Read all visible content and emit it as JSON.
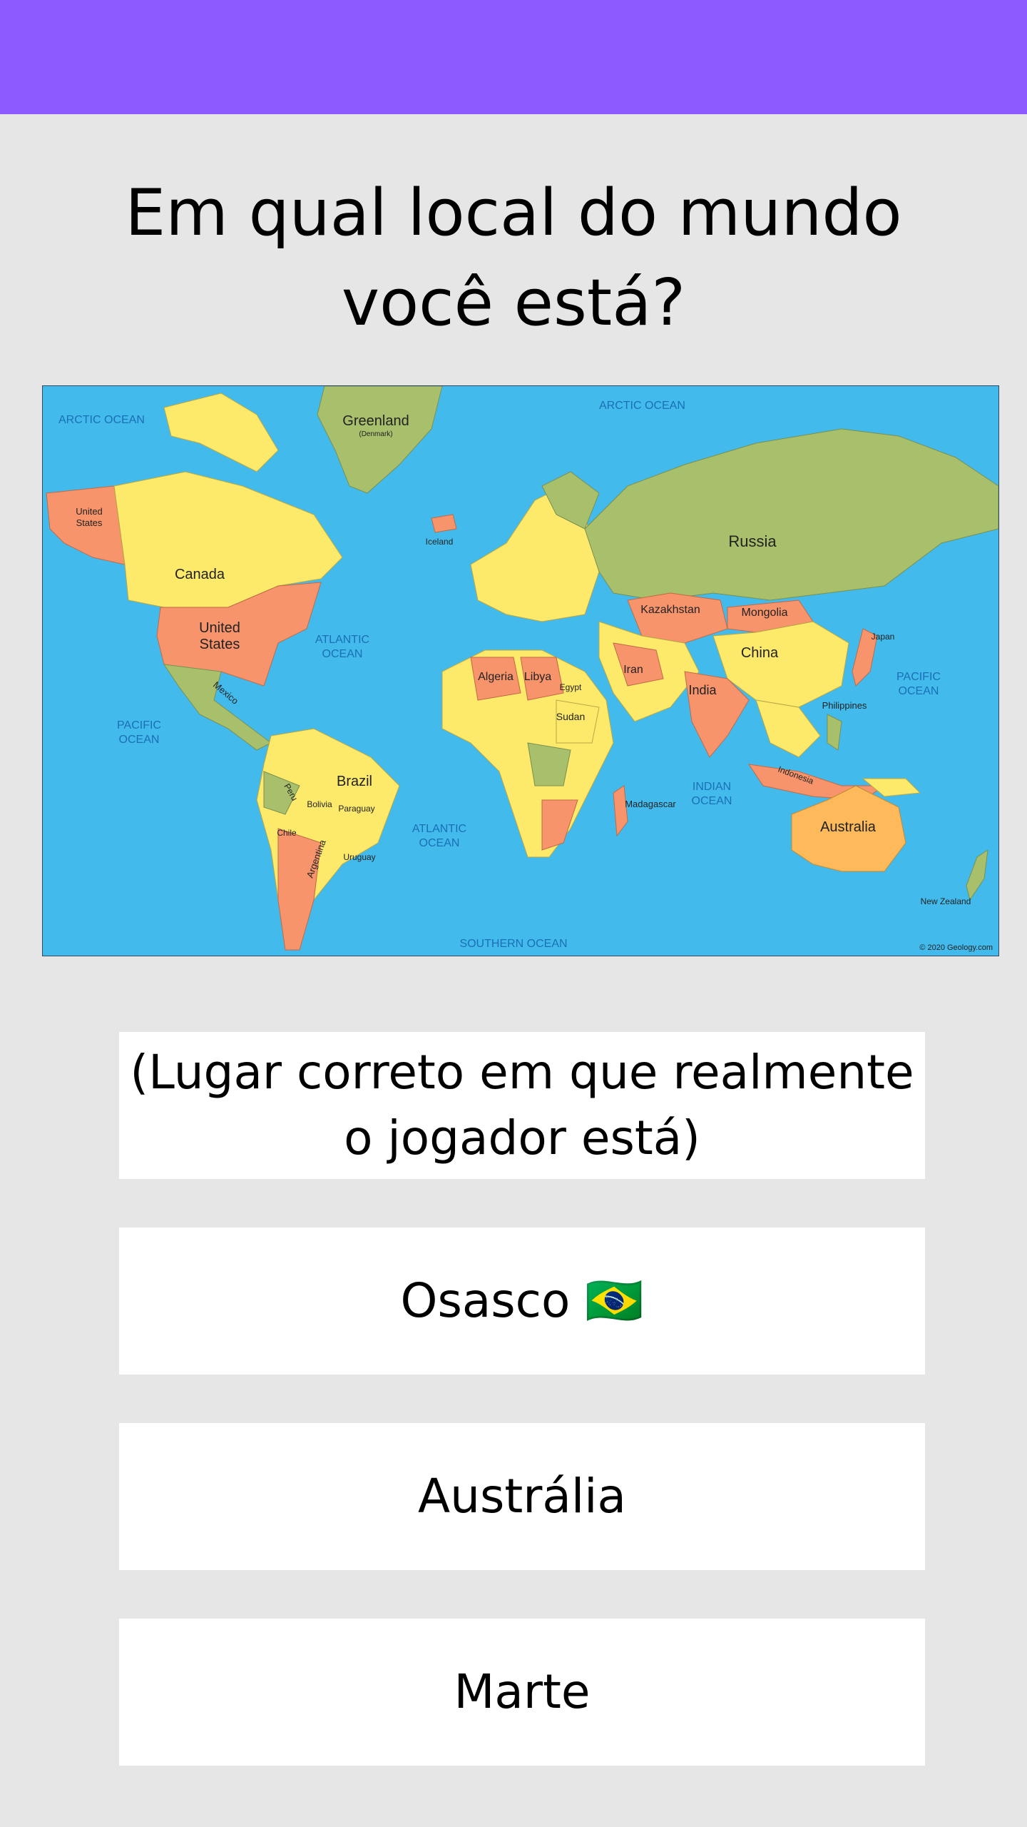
{
  "header": {
    "color": "#8c59ff"
  },
  "question": {
    "text": "Em qual local do mundo você está?"
  },
  "map": {
    "oceans": {
      "arctic_left": "ARCTIC OCEAN",
      "arctic_top": "ARCTIC OCEAN",
      "atlantic_n_1": "ATLANTIC",
      "atlantic_n_2": "OCEAN",
      "atlantic_s_1": "ATLANTIC",
      "atlantic_s_2": "OCEAN",
      "pacific_w_1": "PACIFIC",
      "pacific_w_2": "OCEAN",
      "pacific_e_1": "PACIFIC",
      "pacific_e_2": "OCEAN",
      "indian_1": "INDIAN",
      "indian_2": "OCEAN",
      "southern": "SOUTHERN OCEAN"
    },
    "countries": {
      "greenland": "Greenland",
      "denmark": "(Denmark)",
      "canada": "Canada",
      "us_1": "United",
      "us_2": "States",
      "us_alaska_1": "United",
      "us_alaska_2": "States",
      "mexico": "Mexico",
      "brazil": "Brazil",
      "argentina": "Argentina",
      "russia": "Russia",
      "china": "China",
      "india": "India",
      "kazakhstan": "Kazakhstan",
      "mongolia": "Mongolia",
      "australia": "Australia",
      "algeria": "Algeria",
      "libya": "Libya",
      "iceland": "Iceland",
      "madagascar": "Madagascar",
      "new_zealand": "New Zealand",
      "japan": "Japan",
      "iran": "Iran",
      "sudan": "Sudan",
      "egypt": "Egypt",
      "indonesia": "Indonesia",
      "chile": "Chile",
      "peru": "Peru",
      "bolivia": "Bolivia",
      "uruguay": "Uruguay",
      "paraguay": "Paraguay",
      "philippines": "Philippines"
    },
    "credit": "© 2020 Geology.com"
  },
  "answers": [
    {
      "label": "(Lugar correto em que realmente o jogador está)"
    },
    {
      "label": "Osasco 🇧🇷"
    },
    {
      "label": "Austrália"
    },
    {
      "label": "Marte"
    }
  ]
}
